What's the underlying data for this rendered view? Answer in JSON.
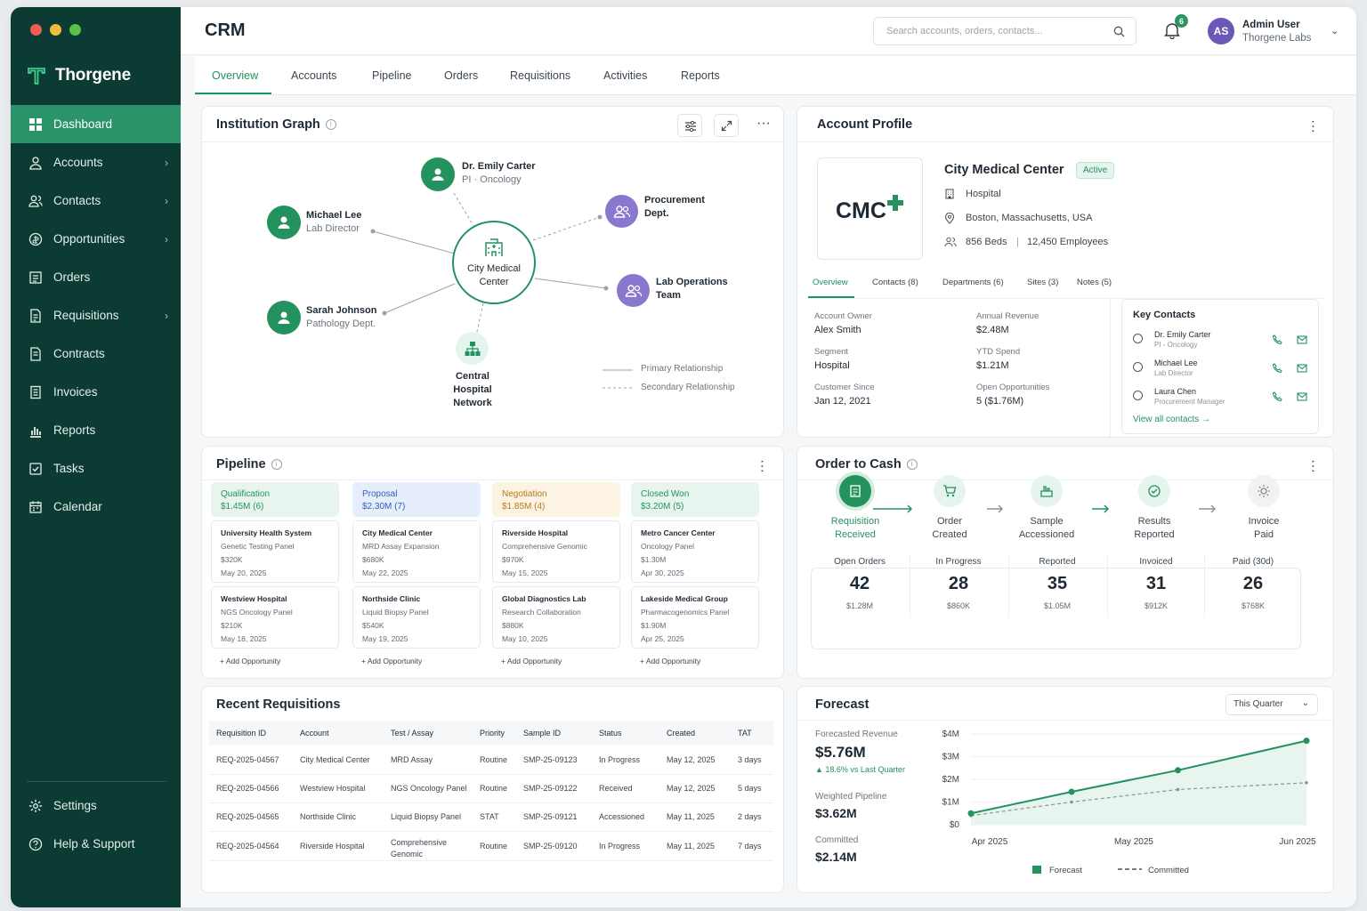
{
  "brand": {
    "name": "Thorgene"
  },
  "nav": {
    "items": [
      {
        "label": "Dashboard",
        "icon": "dashboard-icon",
        "active": true,
        "chev": false
      },
      {
        "label": "Accounts",
        "icon": "accounts-icon",
        "chev": true
      },
      {
        "label": "Contacts",
        "icon": "contacts-icon",
        "chev": true
      },
      {
        "label": "Opportunities",
        "icon": "opportunities-icon",
        "chev": true
      },
      {
        "label": "Orders",
        "icon": "orders-icon",
        "chev": false
      },
      {
        "label": "Requisitions",
        "icon": "requisitions-icon",
        "chev": true
      },
      {
        "label": "Contracts",
        "icon": "contracts-icon",
        "chev": false
      },
      {
        "label": "Invoices",
        "icon": "invoices-icon",
        "chev": false
      },
      {
        "label": "Reports",
        "icon": "reports-icon",
        "chev": false
      },
      {
        "label": "Tasks",
        "icon": "tasks-icon",
        "chev": false
      },
      {
        "label": "Calendar",
        "icon": "calendar-icon",
        "chev": false
      }
    ],
    "bottom": [
      {
        "label": "Settings",
        "icon": "gear-icon"
      },
      {
        "label": "Help & Support",
        "icon": "help-icon"
      }
    ]
  },
  "header": {
    "title": "CRM",
    "search_placeholder": "Search accounts, orders, contacts...",
    "notifications": "6",
    "avatar": "AS",
    "user_name": "Admin User",
    "user_org": "Thorgene Labs"
  },
  "tabs": [
    "Overview",
    "Accounts",
    "Pipeline",
    "Orders",
    "Requisitions",
    "Activities",
    "Reports"
  ],
  "graph": {
    "title": "Institution Graph",
    "center": [
      "City Medical",
      "Center"
    ],
    "nodes": [
      {
        "name": "Dr. Emily Carter",
        "sub": "PI · Oncology"
      },
      {
        "name": "Michael Lee",
        "sub": "Lab Director"
      },
      {
        "name": "Sarah Johnson",
        "sub": "Pathology Dept."
      },
      {
        "name": "Procurement",
        "sub": "Dept."
      },
      {
        "name": "Lab Operations",
        "sub": "Team"
      },
      {
        "name": "Central Hospital",
        "sub": "Network"
      }
    ],
    "legend": {
      "primary": "Primary Relationship",
      "secondary": "Secondary Relationship"
    }
  },
  "profile": {
    "title": "Account Profile",
    "logo": "CMC",
    "name": "City Medical Center",
    "status": "Active",
    "type": "Hospital",
    "location": "Boston, Massachusetts, USA",
    "beds": "856 Beds",
    "sep": "|",
    "employees": "12,450 Employees",
    "tabs": [
      "Overview",
      "Contacts (8)",
      "Departments (6)",
      "Sites (3)",
      "Notes (5)"
    ],
    "fields": [
      {
        "label": "Account Owner",
        "value": "Alex Smith"
      },
      {
        "label": "Annual Revenue",
        "value": "$2.48M"
      },
      {
        "label": "Segment",
        "value": "Hospital"
      },
      {
        "label": "YTD Spend",
        "value": "$1.21M"
      },
      {
        "label": "Customer Since",
        "value": "Jan 12, 2021"
      },
      {
        "label": "Open Opportunities",
        "value": "5 ($1.76M)"
      }
    ],
    "key_contacts_title": "Key Contacts",
    "contacts": [
      {
        "name": "Dr. Emily Carter",
        "role": "PI - Oncology"
      },
      {
        "name": "Michael Lee",
        "role": "Lab Director"
      },
      {
        "name": "Laura Chen",
        "role": "Procurement Manager"
      }
    ],
    "view_all": "View all contacts →"
  },
  "pipeline": {
    "title": "Pipeline",
    "add_label": "+ Add Opportunity",
    "columns": [
      {
        "stage": "Qualification",
        "total": "$1.45M (6)",
        "bg": "#e8f5ee",
        "fg": "#23925f",
        "cards": [
          {
            "name": "University Health System",
            "product": "Genetic Testing Panel",
            "value": "$320K",
            "date": "May 20, 2025"
          },
          {
            "name": "Westview Hospital",
            "product": "NGS Oncology Panel",
            "value": "$210K",
            "date": "May 18, 2025"
          }
        ]
      },
      {
        "stage": "Proposal",
        "total": "$2.30M (7)",
        "bg": "#e7eefb",
        "fg": "#2f5fbd",
        "cards": [
          {
            "name": "City Medical Center",
            "product": "MRD Assay Expansion",
            "value": "$680K",
            "date": "May 22, 2025"
          },
          {
            "name": "Northside Clinic",
            "product": "Liquid Biopsy Panel",
            "value": "$540K",
            "date": "May 19, 2025"
          }
        ]
      },
      {
        "stage": "Negotiation",
        "total": "$1.85M (4)",
        "bg": "#fdf3e3",
        "fg": "#b47a1c",
        "cards": [
          {
            "name": "Riverside Hospital",
            "product": "Comprehensive Genomic",
            "value": "$970K",
            "date": "May 15, 2025"
          },
          {
            "name": "Global Diagnostics Lab",
            "product": "Research Collaboration",
            "value": "$880K",
            "date": "May 10, 2025"
          }
        ]
      },
      {
        "stage": "Closed Won",
        "total": "$3.20M (5)",
        "bg": "#e8f5ee",
        "fg": "#23925f",
        "cards": [
          {
            "name": "Metro Cancer Center",
            "product": "Oncology Panel",
            "value": "$1.30M",
            "date": "Apr 30, 2025"
          },
          {
            "name": "Lakeside Medical Group",
            "product": "Pharmacogenomics Panel",
            "value": "$1.90M",
            "date": "Apr 25, 2025"
          }
        ]
      }
    ]
  },
  "otc": {
    "title": "Order to Cash",
    "steps": [
      {
        "l1": "Requisition",
        "l2": "Received",
        "active": true,
        "icon": "requisition-icon"
      },
      {
        "l1": "Order",
        "l2": "Created",
        "icon": "cart-icon"
      },
      {
        "l1": "Sample",
        "l2": "Accessioned",
        "icon": "sample-icon"
      },
      {
        "l1": "Results",
        "l2": "Reported",
        "icon": "check-icon"
      },
      {
        "l1": "Invoice",
        "l2": "Paid",
        "icon": "sun-icon"
      }
    ],
    "metrics": [
      {
        "label": "Open Orders",
        "value": "42",
        "money": "$1.28M"
      },
      {
        "label": "In Progress",
        "value": "28",
        "money": "$860K"
      },
      {
        "label": "Reported",
        "value": "35",
        "money": "$1.05M"
      },
      {
        "label": "Invoiced",
        "value": "31",
        "money": "$912K"
      },
      {
        "label": "Paid (30d)",
        "value": "26",
        "money": "$768K"
      }
    ]
  },
  "requisitions": {
    "title": "Recent Requisitions",
    "columns": [
      "Requisition ID",
      "Account",
      "Test / Assay",
      "Priority",
      "Sample ID",
      "Status",
      "Created",
      "TAT"
    ],
    "rows": [
      [
        "REQ-2025-04567",
        "City Medical Center",
        "MRD Assay",
        "Routine",
        "SMP-25-09123",
        "In Progress",
        "May 12, 2025",
        "3 days"
      ],
      [
        "REQ-2025-04566",
        "Westview Hospital",
        "NGS Oncology Panel",
        "Routine",
        "SMP-25-09122",
        "Received",
        "May 12, 2025",
        "5 days"
      ],
      [
        "REQ-2025-04565",
        "Northside Clinic",
        "Liquid Biopsy Panel",
        "STAT",
        "SMP-25-09121",
        "Accessioned",
        "May 11, 2025",
        "2 days"
      ],
      [
        "REQ-2025-04564",
        "Riverside Hospital",
        "Comprehensive Genomic",
        "Routine",
        "SMP-25-09120",
        "In Progress",
        "May 11, 2025",
        "7 days"
      ]
    ]
  },
  "forecast": {
    "title": "Forecast",
    "period": "This Quarter",
    "kpis": [
      {
        "label": "Forecasted Revenue",
        "value": "$5.76M",
        "delta": "▲ 18.6% vs Last Quarter"
      },
      {
        "label": "Weighted Pipeline",
        "value": "$3.62M"
      },
      {
        "label": "Committed",
        "value": "$2.14M"
      }
    ]
  },
  "chart_data": {
    "type": "line",
    "x": [
      "Apr 2025",
      "May 2025",
      "Jun 2025"
    ],
    "yticks": [
      "$4M",
      "$3M",
      "$2M",
      "$1M",
      "$0"
    ],
    "ylim": [
      0,
      4
    ],
    "series": [
      {
        "name": "Forecast",
        "color": "#23925f",
        "points": [
          [
            0,
            0.5
          ],
          [
            0.9,
            1.45
          ],
          [
            1.85,
            2.4
          ],
          [
            3.0,
            3.7
          ]
        ]
      },
      {
        "name": "Committed",
        "color": "#8a949c",
        "points": [
          [
            0,
            0.4
          ],
          [
            0.9,
            1.0
          ],
          [
            1.85,
            1.55
          ],
          [
            3.0,
            1.85
          ]
        ]
      }
    ],
    "legend": [
      "Forecast",
      "Committed"
    ],
    "legend_position": "bottom",
    "grid": true
  },
  "colors": {
    "sidebar": "#0c3b34",
    "accent": "#23925f",
    "purple": "#7b68c8"
  }
}
